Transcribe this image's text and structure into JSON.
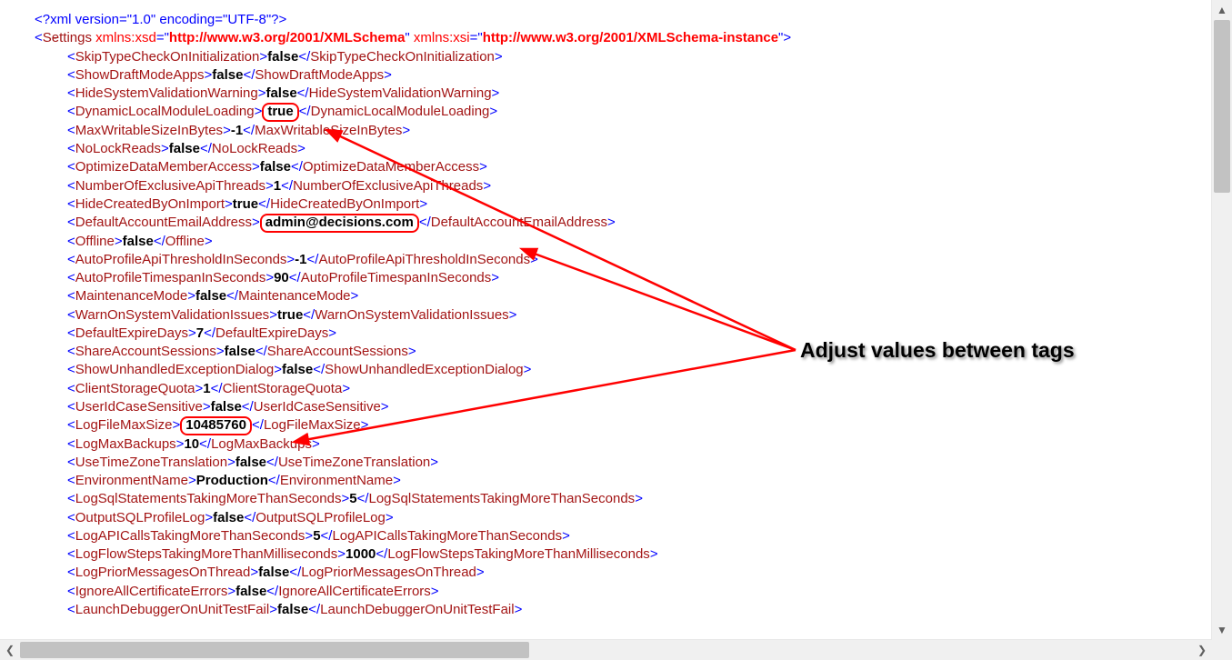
{
  "xml_declaration": "<?xml version=\"1.0\" encoding=\"UTF-8\"?>",
  "root": {
    "name": "Settings",
    "ns1": {
      "prefix": "xmlns:xsd",
      "value": "http://www.w3.org/2001/XMLSchema"
    },
    "ns2": {
      "prefix": "xmlns:xsi",
      "value": "http://www.w3.org/2001/XMLSchema-instance"
    }
  },
  "elements": [
    {
      "name": "SkipTypeCheckOnInitialization",
      "value": "false"
    },
    {
      "name": "ShowDraftModeApps",
      "value": "false"
    },
    {
      "name": "HideSystemValidationWarning",
      "value": "false"
    },
    {
      "name": "DynamicLocalModuleLoading",
      "value": "true",
      "circled": true
    },
    {
      "name": "MaxWritableSizeInBytes",
      "value": "-1"
    },
    {
      "name": "NoLockReads",
      "value": "false"
    },
    {
      "name": "OptimizeDataMemberAccess",
      "value": "false"
    },
    {
      "name": "NumberOfExclusiveApiThreads",
      "value": "1"
    },
    {
      "name": "HideCreatedByOnImport",
      "value": "true"
    },
    {
      "name": "DefaultAccountEmailAddress",
      "value": "admin@decisions.com",
      "circled": true
    },
    {
      "name": "Offline",
      "value": "false"
    },
    {
      "name": "AutoProfileApiThresholdInSeconds",
      "value": "-1"
    },
    {
      "name": "AutoProfileTimespanInSeconds",
      "value": "90"
    },
    {
      "name": "MaintenanceMode",
      "value": "false"
    },
    {
      "name": "WarnOnSystemValidationIssues",
      "value": "true"
    },
    {
      "name": "DefaultExpireDays",
      "value": "7"
    },
    {
      "name": "ShareAccountSessions",
      "value": "false"
    },
    {
      "name": "ShowUnhandledExceptionDialog",
      "value": "false"
    },
    {
      "name": "ClientStorageQuota",
      "value": "1"
    },
    {
      "name": "UserIdCaseSensitive",
      "value": "false"
    },
    {
      "name": "LogFileMaxSize",
      "value": "10485760",
      "circled": true
    },
    {
      "name": "LogMaxBackups",
      "value": "10"
    },
    {
      "name": "UseTimeZoneTranslation",
      "value": "false"
    },
    {
      "name": "EnvironmentName",
      "value": "Production"
    },
    {
      "name": "LogSqlStatementsTakingMoreThanSeconds",
      "value": "5"
    },
    {
      "name": "OutputSQLProfileLog",
      "value": "false"
    },
    {
      "name": "LogAPICallsTakingMoreThanSeconds",
      "value": "5"
    },
    {
      "name": "LogFlowStepsTakingMoreThanMilliseconds",
      "value": "1000"
    },
    {
      "name": "LogPriorMessagesOnThread",
      "value": "false"
    },
    {
      "name": "IgnoreAllCertificateErrors",
      "value": "false"
    },
    {
      "name": "LaunchDebuggerOnUnitTestFail",
      "value": "false"
    }
  ],
  "annotation": {
    "label": "Adjust values between tags"
  },
  "collapse_marker": "-"
}
